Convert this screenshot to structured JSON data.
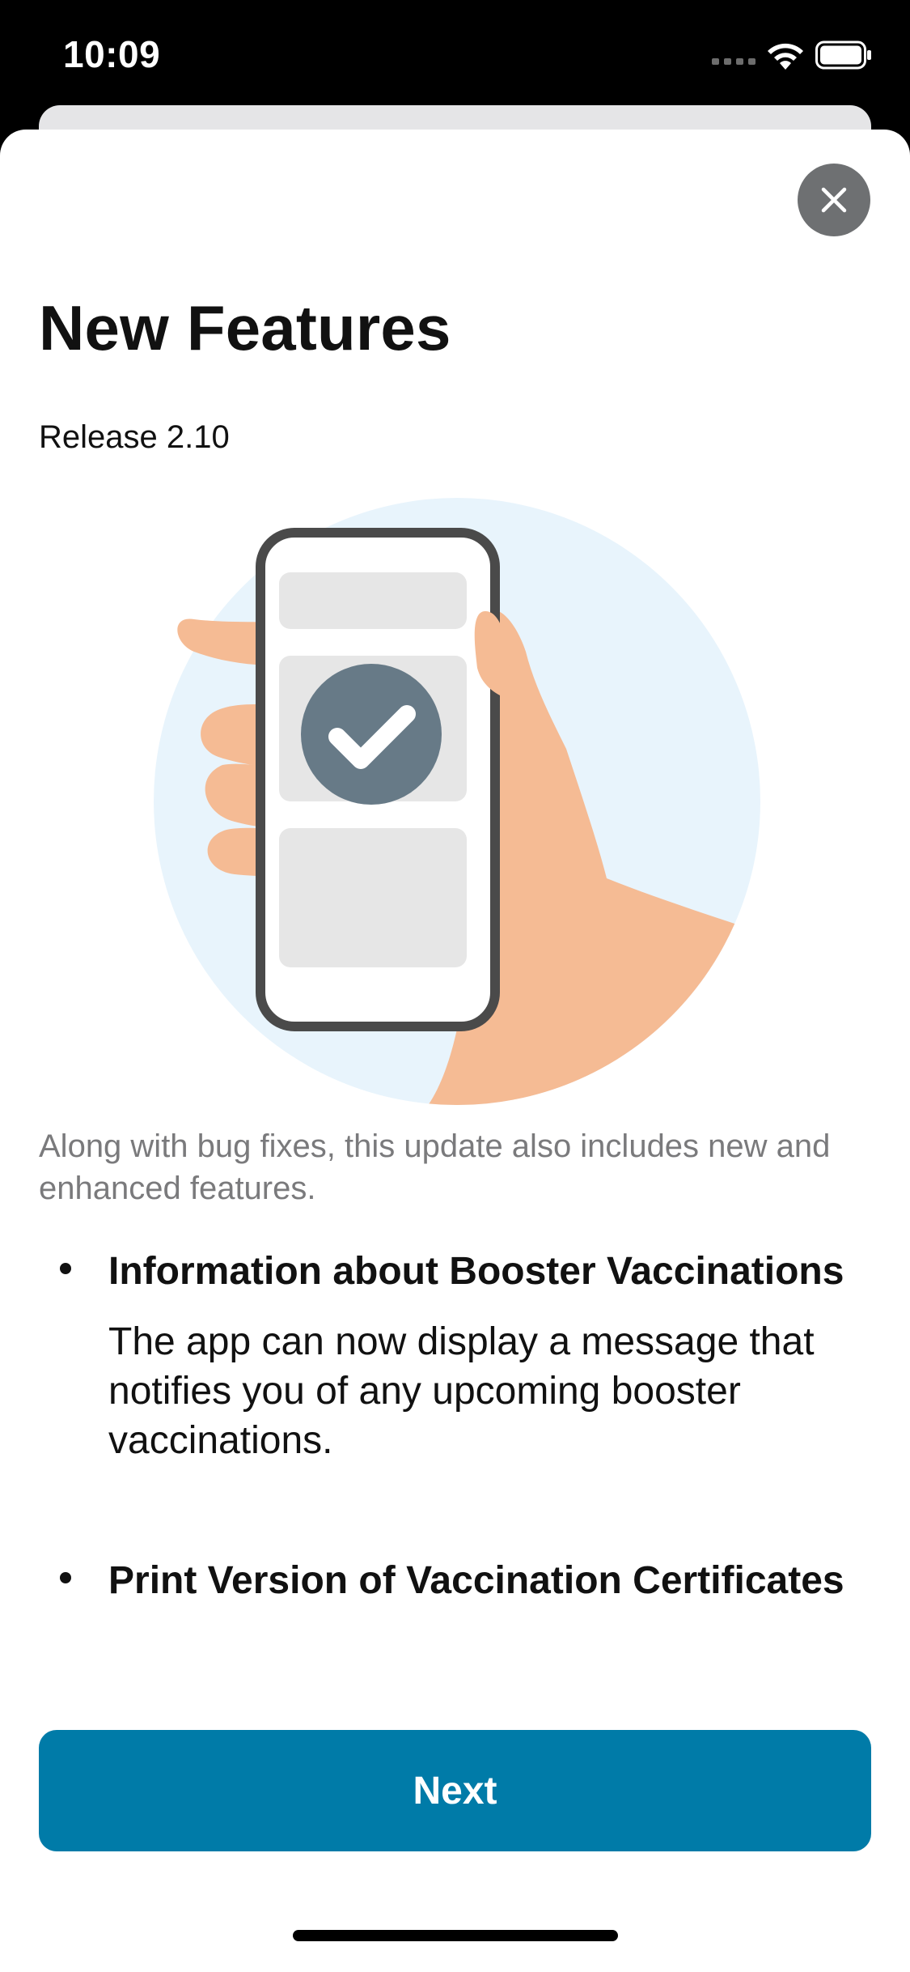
{
  "status_bar": {
    "time": "10:09",
    "icons": [
      "signal-icon",
      "wifi-icon",
      "battery-icon"
    ]
  },
  "sheet": {
    "close_icon": "close-icon",
    "title": "New Features",
    "release": "Release 2.10",
    "illustration": "hand-holding-phone-with-checkmark",
    "intro": "Along with bug fixes, this update also includes new and enhanced features.",
    "features": [
      {
        "title": "Information about Booster Vaccinations",
        "description": "The app can now display a message that notifies you of any upcoming booster vaccinations."
      },
      {
        "title": "Print Version of Vaccination Certificates",
        "description": ""
      }
    ],
    "next_label": "Next"
  },
  "colors": {
    "accent": "#007ba8",
    "circle_bg": "#e8f4fc",
    "skin": "#f5bb94",
    "phone_frame": "#4a4a4a",
    "check_badge": "#677a87"
  }
}
